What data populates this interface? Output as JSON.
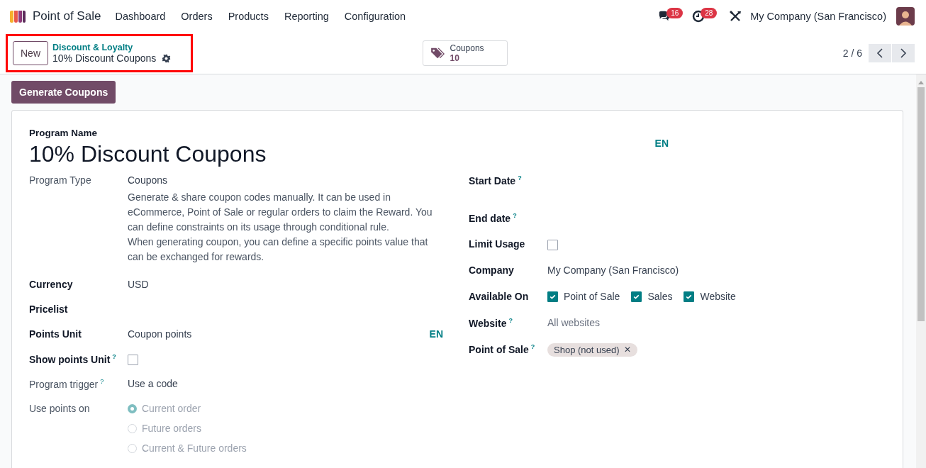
{
  "navbar": {
    "app_name": "Point of Sale",
    "menu": [
      "Dashboard",
      "Orders",
      "Products",
      "Reporting",
      "Configuration"
    ],
    "messages_badge": "16",
    "activities_badge": "28",
    "company": "My Company (San Francisco)"
  },
  "control_panel": {
    "highlighted": true,
    "new_button": "New",
    "breadcrumb_parent": "Discount & Loyalty",
    "breadcrumb_current": "10% Discount Coupons",
    "smart_button": {
      "label": "Coupons",
      "count": "10"
    },
    "pager": "2 / 6"
  },
  "action_button": "Generate Coupons",
  "form": {
    "name_label": "Program Name",
    "name": "10% Discount Coupons",
    "name_lang": "EN",
    "left_fields": [
      {
        "kind": "description",
        "label": "Program Type",
        "readonly": true,
        "value": "Coupons",
        "description": [
          "Generate & share coupon codes manually. It can be used in eCommerce, Point of Sale or regular orders to claim the Reward. You can define constraints on its usage through conditional rule.",
          "When generating coupon, you can define a specific points value that can be exchanged for rewards."
        ]
      },
      {
        "kind": "text",
        "label": "Currency",
        "readonly": false,
        "value": "USD"
      },
      {
        "kind": "text",
        "label": "Pricelist",
        "readonly": false
      },
      {
        "kind": "text",
        "label": "Points Unit",
        "readonly": false,
        "value": "Coupon points",
        "lang": "EN"
      },
      {
        "kind": "checkbox",
        "label": "Show points Unit",
        "readonly": false,
        "help": "?",
        "checked": false
      },
      {
        "kind": "text",
        "label": "Program trigger",
        "readonly": true,
        "help": "?",
        "value": "Use a code"
      },
      {
        "kind": "radio",
        "label": "Use points on",
        "readonly": true,
        "options": [
          {
            "label": "Current order",
            "selected": true,
            "disabled": true
          },
          {
            "label": "Future orders",
            "selected": false,
            "disabled": true
          },
          {
            "label": "Current & Future orders",
            "selected": false,
            "disabled": true
          }
        ]
      }
    ],
    "right_fields": [
      {
        "kind": "text",
        "label": "Start Date",
        "readonly": false,
        "help": "?"
      },
      {
        "kind": "text",
        "label": "End date",
        "readonly": false,
        "help": "?"
      },
      {
        "kind": "checkbox",
        "label": "Limit Usage",
        "readonly": false,
        "checked": false
      },
      {
        "kind": "text",
        "label": "Company",
        "readonly": false,
        "value": "My Company (San Francisco)"
      },
      {
        "kind": "checkboxes",
        "label": "Available On",
        "readonly": false,
        "options": [
          {
            "label": "Point of Sale",
            "checked": true
          },
          {
            "label": "Sales",
            "checked": true
          },
          {
            "label": "Website",
            "checked": true
          }
        ]
      },
      {
        "kind": "placeholder",
        "label": "Website",
        "readonly": false,
        "help": "?",
        "placeholder": "All websites"
      },
      {
        "kind": "tags",
        "label": "Point of Sale",
        "readonly": false,
        "help": "?",
        "tags": [
          {
            "label": "Shop (not used)",
            "remove": "✕"
          }
        ]
      }
    ]
  }
}
